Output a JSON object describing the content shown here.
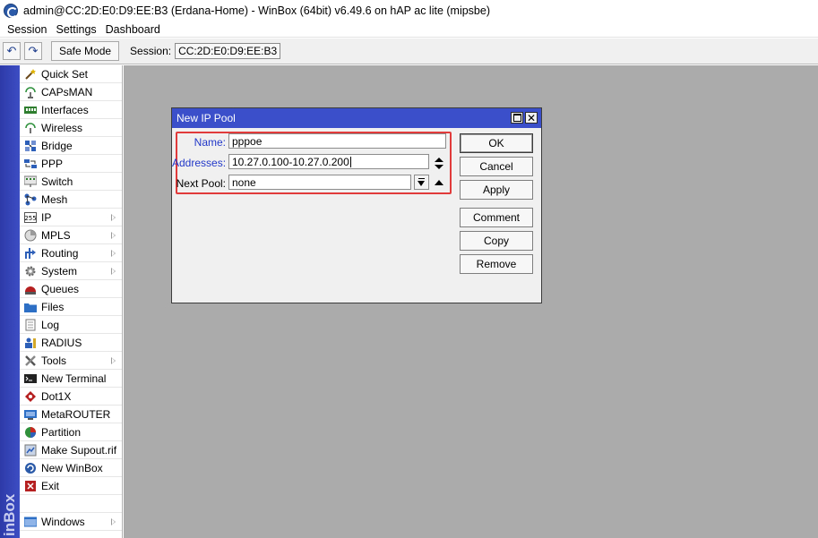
{
  "window": {
    "title": "admin@CC:2D:E0:D9:EE:B3 (Erdana-Home) - WinBox (64bit) v6.49.6 on hAP ac lite (mipsbe)"
  },
  "menu": [
    "Session",
    "Settings",
    "Dashboard"
  ],
  "toolbar": {
    "undo_glyph": "↶",
    "redo_glyph": "↷",
    "safe_mode_label": "Safe Mode",
    "session_label": "Session:",
    "session_value": "CC:2D:E0:D9:EE:B3"
  },
  "brand_strip": "inBox",
  "sidebar": {
    "items": [
      {
        "label": "Quick Set",
        "icon": "wand-icon",
        "submenu": false
      },
      {
        "label": "CAPsMAN",
        "icon": "capsman-icon",
        "submenu": false
      },
      {
        "label": "Interfaces",
        "icon": "interfaces-icon",
        "submenu": false
      },
      {
        "label": "Wireless",
        "icon": "wireless-icon",
        "submenu": false
      },
      {
        "label": "Bridge",
        "icon": "bridge-icon",
        "submenu": false
      },
      {
        "label": "PPP",
        "icon": "ppp-icon",
        "submenu": false
      },
      {
        "label": "Switch",
        "icon": "switch-icon",
        "submenu": false
      },
      {
        "label": "Mesh",
        "icon": "mesh-icon",
        "submenu": false
      },
      {
        "label": "IP",
        "icon": "ip-icon",
        "submenu": true
      },
      {
        "label": "MPLS",
        "icon": "mpls-icon",
        "submenu": true
      },
      {
        "label": "Routing",
        "icon": "routing-icon",
        "submenu": true
      },
      {
        "label": "System",
        "icon": "system-gear-icon",
        "submenu": true
      },
      {
        "label": "Queues",
        "icon": "queues-icon",
        "submenu": false
      },
      {
        "label": "Files",
        "icon": "folder-icon",
        "submenu": false
      },
      {
        "label": "Log",
        "icon": "log-icon",
        "submenu": false
      },
      {
        "label": "RADIUS",
        "icon": "radius-icon",
        "submenu": false
      },
      {
        "label": "Tools",
        "icon": "tools-icon",
        "submenu": true
      },
      {
        "label": "New Terminal",
        "icon": "terminal-icon",
        "submenu": false
      },
      {
        "label": "Dot1X",
        "icon": "dot1x-icon",
        "submenu": false
      },
      {
        "label": "MetaROUTER",
        "icon": "metarouter-icon",
        "submenu": false
      },
      {
        "label": "Partition",
        "icon": "partition-icon",
        "submenu": false
      },
      {
        "label": "Make Supout.rif",
        "icon": "supout-icon",
        "submenu": false
      },
      {
        "label": "New WinBox",
        "icon": "winbox-icon",
        "submenu": false
      },
      {
        "label": "Exit",
        "icon": "exit-icon",
        "submenu": false
      }
    ],
    "windows": {
      "label": "Windows",
      "icon": "windows-icon",
      "submenu": true
    }
  },
  "dialog": {
    "title": "New IP Pool",
    "fields": {
      "name": {
        "label": "Name:",
        "value": "pppoe"
      },
      "addresses": {
        "label": "Addresses:",
        "value": "10.27.0.100-10.27.0.200"
      },
      "next_pool": {
        "label": "Next Pool:",
        "value": "none"
      }
    },
    "buttons": {
      "ok": "OK",
      "cancel": "Cancel",
      "apply": "Apply",
      "comment": "Comment",
      "copy": "Copy",
      "remove": "Remove"
    },
    "close_glyph": "✕"
  },
  "colors": {
    "dialog_title_bg": "#3a4fc9",
    "strip_bg": "#2d3aa8",
    "workspace_bg": "#ababab",
    "highlight_border": "#e23b3b",
    "label_blue": "#2238c8"
  }
}
